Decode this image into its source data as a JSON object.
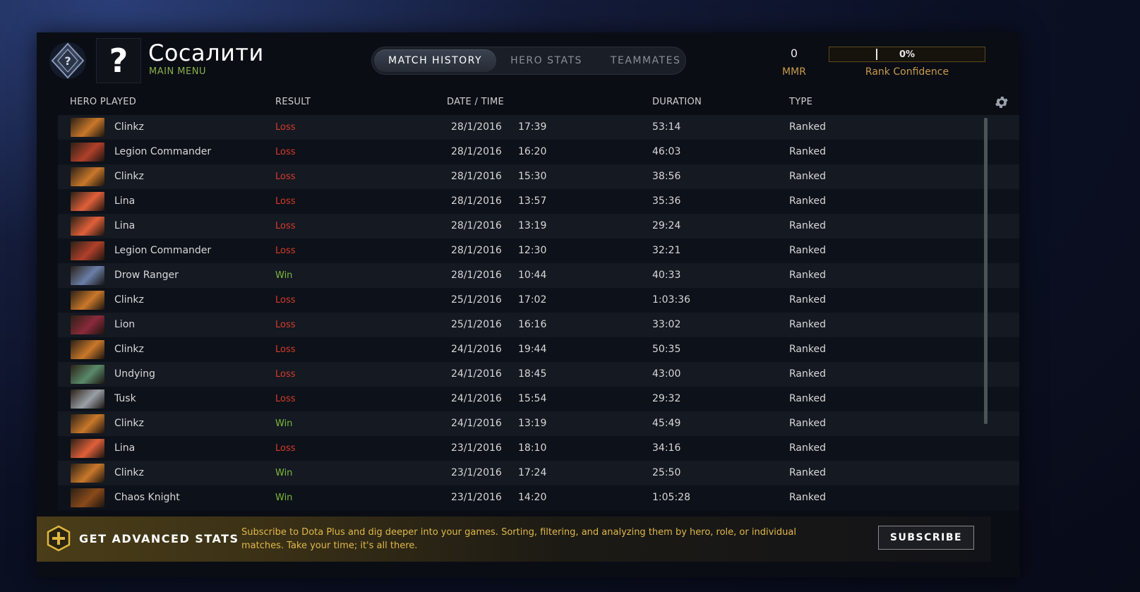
{
  "profile": {
    "avatar_glyph": "?",
    "name": "Сосалити",
    "subtitle": "MAIN MENU"
  },
  "tabs": [
    {
      "label": "MATCH HISTORY",
      "active": true
    },
    {
      "label": "HERO STATS",
      "active": false
    },
    {
      "label": "TEAMMATES",
      "active": false
    }
  ],
  "mmr": {
    "value": "0",
    "label": "MMR"
  },
  "rank_confidence": {
    "percent_text": "0%",
    "fraction": 0.0,
    "label": "Rank Confidence"
  },
  "columns": {
    "hero": "HERO PLAYED",
    "result": "RESULT",
    "datetime": "DATE / TIME",
    "duration": "DURATION",
    "type": "TYPE"
  },
  "matches": [
    {
      "hero": "Clinkz",
      "result": "Loss",
      "date": "28/1/2016",
      "time": "17:39",
      "duration": "53:14",
      "type": "Ranked",
      "icon_color": "#c9782a"
    },
    {
      "hero": "Legion Commander",
      "result": "Loss",
      "date": "28/1/2016",
      "time": "16:20",
      "duration": "46:03",
      "type": "Ranked",
      "icon_color": "#b0402a"
    },
    {
      "hero": "Clinkz",
      "result": "Loss",
      "date": "28/1/2016",
      "time": "15:30",
      "duration": "38:56",
      "type": "Ranked",
      "icon_color": "#c9782a"
    },
    {
      "hero": "Lina",
      "result": "Loss",
      "date": "28/1/2016",
      "time": "13:57",
      "duration": "35:36",
      "type": "Ranked",
      "icon_color": "#e0603a"
    },
    {
      "hero": "Lina",
      "result": "Loss",
      "date": "28/1/2016",
      "time": "13:19",
      "duration": "29:24",
      "type": "Ranked",
      "icon_color": "#e0603a"
    },
    {
      "hero": "Legion Commander",
      "result": "Loss",
      "date": "28/1/2016",
      "time": "12:30",
      "duration": "32:21",
      "type": "Ranked",
      "icon_color": "#b0402a"
    },
    {
      "hero": "Drow Ranger",
      "result": "Win",
      "date": "28/1/2016",
      "time": "10:44",
      "duration": "40:33",
      "type": "Ranked",
      "icon_color": "#6a7fa8"
    },
    {
      "hero": "Clinkz",
      "result": "Loss",
      "date": "25/1/2016",
      "time": "17:02",
      "duration": "1:03:36",
      "type": "Ranked",
      "icon_color": "#c9782a"
    },
    {
      "hero": "Lion",
      "result": "Loss",
      "date": "25/1/2016",
      "time": "16:16",
      "duration": "33:02",
      "type": "Ranked",
      "icon_color": "#8a2a3a"
    },
    {
      "hero": "Clinkz",
      "result": "Loss",
      "date": "24/1/2016",
      "time": "19:44",
      "duration": "50:35",
      "type": "Ranked",
      "icon_color": "#c9782a"
    },
    {
      "hero": "Undying",
      "result": "Loss",
      "date": "24/1/2016",
      "time": "18:45",
      "duration": "43:00",
      "type": "Ranked",
      "icon_color": "#5a8a6a"
    },
    {
      "hero": "Tusk",
      "result": "Loss",
      "date": "24/1/2016",
      "time": "15:54",
      "duration": "29:32",
      "type": "Ranked",
      "icon_color": "#9aa0a8"
    },
    {
      "hero": "Clinkz",
      "result": "Win",
      "date": "24/1/2016",
      "time": "13:19",
      "duration": "45:49",
      "type": "Ranked",
      "icon_color": "#c9782a"
    },
    {
      "hero": "Lina",
      "result": "Loss",
      "date": "23/1/2016",
      "time": "18:10",
      "duration": "34:16",
      "type": "Ranked",
      "icon_color": "#e0603a"
    },
    {
      "hero": "Clinkz",
      "result": "Win",
      "date": "23/1/2016",
      "time": "17:24",
      "duration": "25:50",
      "type": "Ranked",
      "icon_color": "#c9782a"
    },
    {
      "hero": "Chaos Knight",
      "result": "Win",
      "date": "23/1/2016",
      "time": "14:20",
      "duration": "1:05:28",
      "type": "Ranked",
      "icon_color": "#8a4a1a"
    }
  ],
  "promo": {
    "title": "GET ADVANCED STATS",
    "text": "Subscribe to Dota Plus and dig deeper into your games. Sorting, filtering, and analyzing them by hero, role, or individual matches. Take your time; it's all there.",
    "button": "SUBSCRIBE"
  },
  "colors": {
    "loss": "#d63b2b",
    "win": "#7fb83a",
    "gold": "#c89a4a",
    "accent_green": "#8ab04a"
  },
  "icons": {
    "rank_emblem": "rank-medal-icon",
    "settings": "gear-icon",
    "promo": "dota-plus-icon"
  }
}
